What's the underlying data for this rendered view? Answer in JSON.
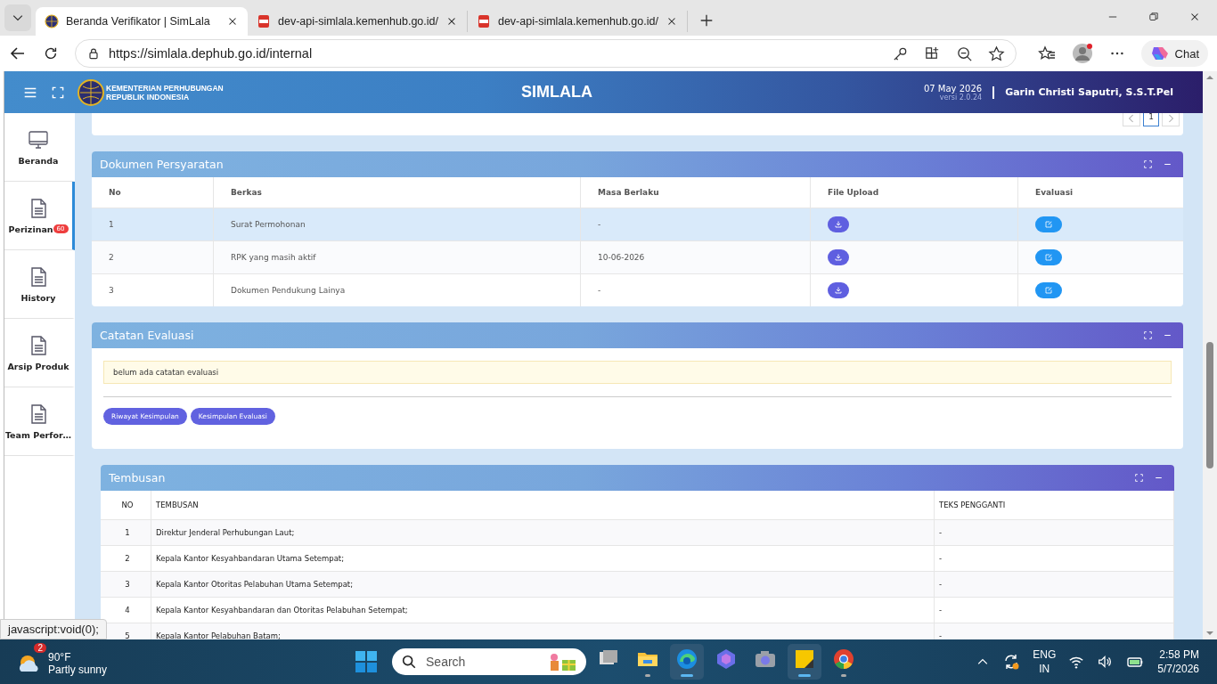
{
  "browser": {
    "tabs": [
      {
        "title": "Beranda Verifikator | SimLala",
        "kind": "site",
        "selected": true
      },
      {
        "title": "dev-api-simlala.kemenhub.go.id/",
        "kind": "pdf",
        "selected": false
      },
      {
        "title": "dev-api-simlala.kemenhub.go.id/",
        "kind": "pdf",
        "selected": false
      }
    ],
    "url": "https://simlala.dephub.go.id/internal",
    "chat_label": "Chat",
    "status_link": "javascript:void(0);"
  },
  "header": {
    "org_lines": [
      "KEMENTERIAN PERHUBUNGAN",
      "REPUBLIK INDONESIA"
    ],
    "title": "SIMLALA",
    "date": "07 May 2026",
    "version": "versi 2.0.24",
    "user": "Garin Christi Saputri, S.S.T.Pel"
  },
  "sidebar": {
    "items": [
      {
        "label": "Beranda",
        "kind": "monitor",
        "selected": false
      },
      {
        "label": "Perizinan",
        "kind": "document",
        "badge": "60",
        "selected": true
      },
      {
        "label": "History",
        "kind": "document",
        "selected": false
      },
      {
        "label": "Arsip Produk",
        "kind": "document",
        "selected": false
      },
      {
        "label": "Team Perfor…",
        "kind": "document",
        "selected": false
      }
    ]
  },
  "pagination": {
    "pages": [
      {
        "label": "1",
        "selected": true
      }
    ]
  },
  "dokumen": {
    "title": "Dokumen Persyaratan",
    "columns": [
      "No",
      "Berkas",
      "Masa Berlaku",
      "File Upload",
      "Evaluasi"
    ],
    "rows": [
      {
        "no": "1",
        "berkas": "Surat Permohonan",
        "masa_berlaku": "-",
        "selected": true
      },
      {
        "no": "2",
        "berkas": "RPK yang masih aktif",
        "masa_berlaku": "10-06-2026",
        "selected": false
      },
      {
        "no": "3",
        "berkas": "Dokumen Pendukung Lainya",
        "masa_berlaku": "-",
        "selected": false
      }
    ]
  },
  "catatan": {
    "title": "Catatan Evaluasi",
    "note": "belum ada catatan evaluasi",
    "buttons": [
      "Riwayat Kesimpulan",
      "Kesimpulan Evaluasi"
    ]
  },
  "tembusan": {
    "title": "Tembusan",
    "columns": [
      "NO",
      "TEMBUSAN",
      "TEKS PENGGANTI"
    ],
    "rows": [
      {
        "no": "1",
        "tembusan": "Direktur Jenderal Perhubungan Laut;",
        "teks_pengganti": "-"
      },
      {
        "no": "2",
        "tembusan": "Kepala Kantor Kesyahbandaran Utama Setempat;",
        "teks_pengganti": "-"
      },
      {
        "no": "3",
        "tembusan": "Kepala Kantor Otoritas Pelabuhan Utama Setempat;",
        "teks_pengganti": "-"
      },
      {
        "no": "4",
        "tembusan": "Kepala Kantor Kesyahbandaran dan Otoritas Pelabuhan Setempat;",
        "teks_pengganti": "-"
      },
      {
        "no": "5",
        "tembusan": "Kepala Kantor Pelabuhan Batam;",
        "teks_pengganti": "-"
      }
    ]
  },
  "taskbar": {
    "weather": {
      "temp": "90°F",
      "condition": "Partly sunny",
      "badge": "2"
    },
    "search_label": "Search",
    "apps": [
      {
        "kind": "taskview",
        "running": false,
        "selected": false
      },
      {
        "kind": "folder",
        "running": true,
        "selected": false
      },
      {
        "kind": "edge",
        "running": true,
        "selected": true
      },
      {
        "kind": "copilot",
        "running": false,
        "selected": false
      },
      {
        "kind": "camera",
        "running": false,
        "selected": false
      },
      {
        "kind": "notes",
        "running": true,
        "selected": true
      },
      {
        "kind": "chrome",
        "running": true,
        "selected": false
      }
    ],
    "tray": {
      "lang": "ENG",
      "region": "IN",
      "time": "2:58 PM",
      "date": "5/7/2026"
    }
  }
}
